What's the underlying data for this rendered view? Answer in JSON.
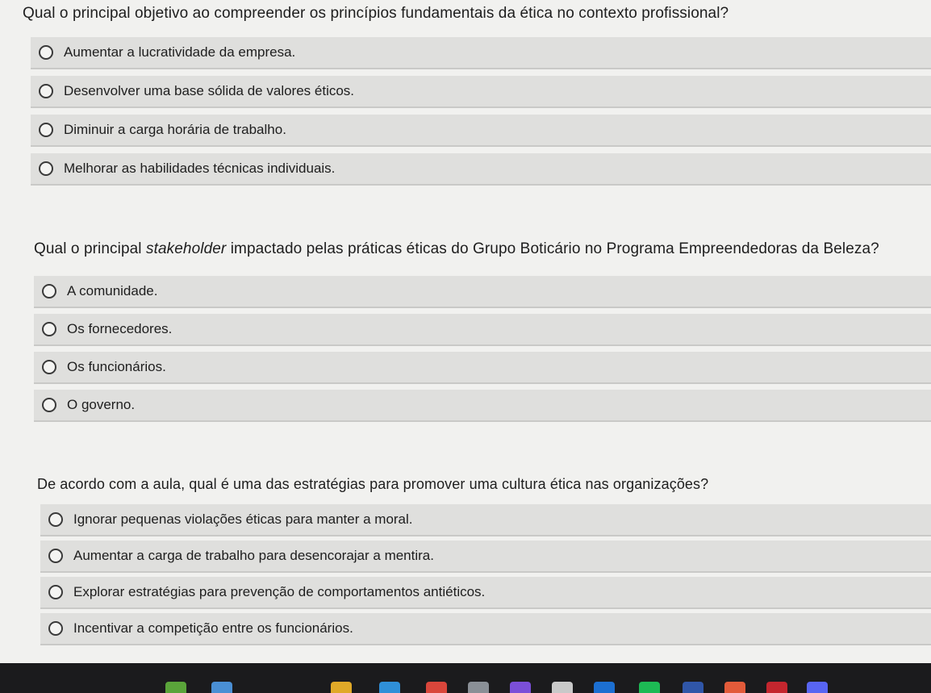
{
  "questions": [
    {
      "title_pre": "Qual o principal objetivo ao compreender os princípios fundamentais da ética no contexto profissional?",
      "title_em": "",
      "title_post": "",
      "options": [
        "Aumentar a lucratividade da empresa.",
        "Desenvolver uma base sólida de valores éticos.",
        "Diminuir a carga horária de trabalho.",
        "Melhorar as habilidades técnicas individuais."
      ]
    },
    {
      "title_pre": "Qual o principal ",
      "title_em": "stakeholder",
      "title_post": " impactado pelas práticas éticas do Grupo Boticário no Programa Empreendedoras da Beleza?",
      "options": [
        "A comunidade.",
        "Os fornecedores.",
        "Os funcionários.",
        "O governo."
      ]
    },
    {
      "title_pre": "De acordo com a aula, qual é uma das estratégias para promover uma cultura ética nas organizações?",
      "title_em": "",
      "title_post": "",
      "options": [
        "Ignorar pequenas violações éticas para manter a moral.",
        "Aumentar a carga de trabalho para desencorajar a mentira.",
        "Explorar estratégias para prevenção de comportamentos antiéticos.",
        "Incentivar a competição entre os funcionários."
      ]
    }
  ],
  "taskbar": {
    "icons": [
      {
        "name": "taskbar-app-icon-1",
        "color": "#5aa43a"
      },
      {
        "name": "taskbar-app-icon-2",
        "color": "#4a8fd4"
      },
      {
        "name": "taskbar-folder-icon",
        "color": "#e0a928"
      },
      {
        "name": "taskbar-app-icon-3",
        "color": "#2f8fd8"
      },
      {
        "name": "taskbar-app-icon-4",
        "color": "#d9463b"
      },
      {
        "name": "taskbar-app-icon-5",
        "color": "#8a8f96"
      },
      {
        "name": "taskbar-app-icon-6",
        "color": "#7b4fd8"
      },
      {
        "name": "taskbar-app-icon-7",
        "color": "#c9c9c9"
      },
      {
        "name": "taskbar-app-icon-8",
        "color": "#1c6fd1"
      },
      {
        "name": "taskbar-spotify-icon",
        "color": "#1db954"
      },
      {
        "name": "taskbar-app-icon-9",
        "color": "#3056a8"
      },
      {
        "name": "taskbar-app-icon-10",
        "color": "#e25b3a"
      },
      {
        "name": "taskbar-app-icon-11",
        "color": "#c4262e"
      },
      {
        "name": "taskbar-discord-icon",
        "color": "#5865f2"
      }
    ]
  }
}
